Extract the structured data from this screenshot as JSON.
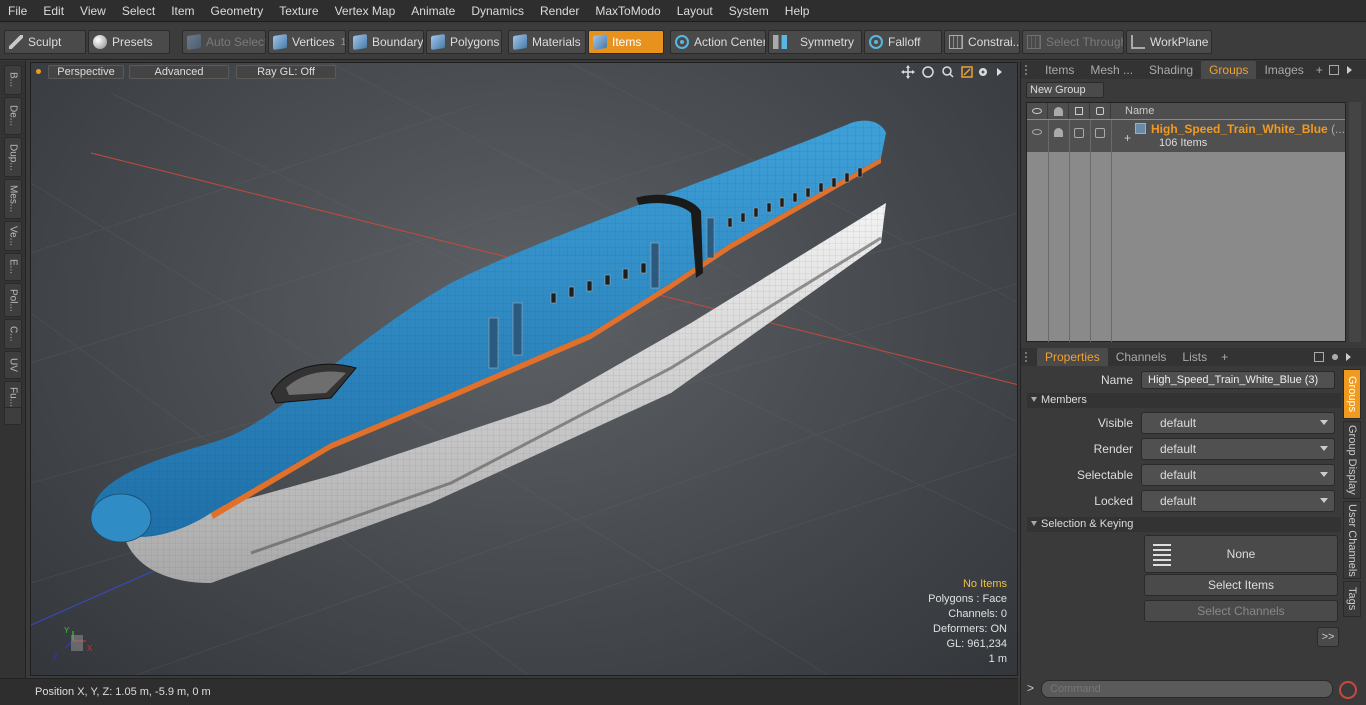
{
  "menu": [
    "File",
    "Edit",
    "View",
    "Select",
    "Item",
    "Geometry",
    "Texture",
    "Vertex Map",
    "Animate",
    "Dynamics",
    "Render",
    "MaxToModo",
    "Layout",
    "System",
    "Help"
  ],
  "toolbar": {
    "sculpt": "Sculpt",
    "presets": "Presets",
    "auto_select": "Auto Select",
    "vertices": "Vertices",
    "vertices_count": "1",
    "boundary": "Boundary",
    "polygons": "Polygons",
    "materials": "Materials",
    "items": "Items",
    "action_center": "Action Center",
    "symmetry": "Symmetry",
    "falloff": "Falloff",
    "constraints": "Constrai...",
    "select_through": "Select Through",
    "workplane": "WorkPlane"
  },
  "left_tabs": [
    "B...",
    "De...",
    "Dup...",
    "Mes...",
    "Ve...",
    "E...",
    "Pol...",
    "C...",
    "UV",
    "Fu..."
  ],
  "viewport": {
    "view": "Perspective",
    "mode": "Advanced",
    "raygl": "Ray GL: Off",
    "info": {
      "no_items": "No Items",
      "polygons": "Polygons : Face",
      "channels": "Channels: 0",
      "deformers": "Deformers: ON",
      "gl": "GL: 961,234",
      "scale": "1 m"
    },
    "axis_labels": {
      "y": "Y",
      "x": "X",
      "z": "Z"
    }
  },
  "status": {
    "position": "Position X, Y, Z:   1.05 m, -5.9 m, 0 m"
  },
  "right_top": {
    "tabs": [
      "Items",
      "Mesh ...",
      "Shading",
      "Groups",
      "Images"
    ],
    "active_tab": "Groups",
    "plus": "+",
    "new_group": "New Group",
    "name_col": "Name",
    "group_name": "High_Speed_Train_White_Blue",
    "group_suffix": "(...",
    "group_count": "106 Items"
  },
  "right_bottom": {
    "tabs": [
      "Properties",
      "Channels",
      "Lists"
    ],
    "plus": "+",
    "name_label": "Name",
    "name_value": "High_Speed_Train_White_Blue (3)",
    "members": "Members",
    "visible_label": "Visible",
    "visible_value": "default",
    "render_label": "Render",
    "render_value": "default",
    "selectable_label": "Selectable",
    "selectable_value": "default",
    "locked_label": "Locked",
    "locked_value": "default",
    "sel_keying": "Selection & Keying",
    "none": "None",
    "select_items": "Select Items",
    "select_channels": "Select Channels",
    "more": ">>",
    "vtabs": [
      "Groups",
      "Group Display",
      "User Channels",
      "Tags"
    ]
  },
  "command": {
    "prompt": ">",
    "placeholder": "Command"
  },
  "colors": {
    "accent": "#f09a20",
    "train_blue": "#2f8cc4",
    "train_stripe": "#e0702a",
    "train_white": "#e8e8e8"
  }
}
